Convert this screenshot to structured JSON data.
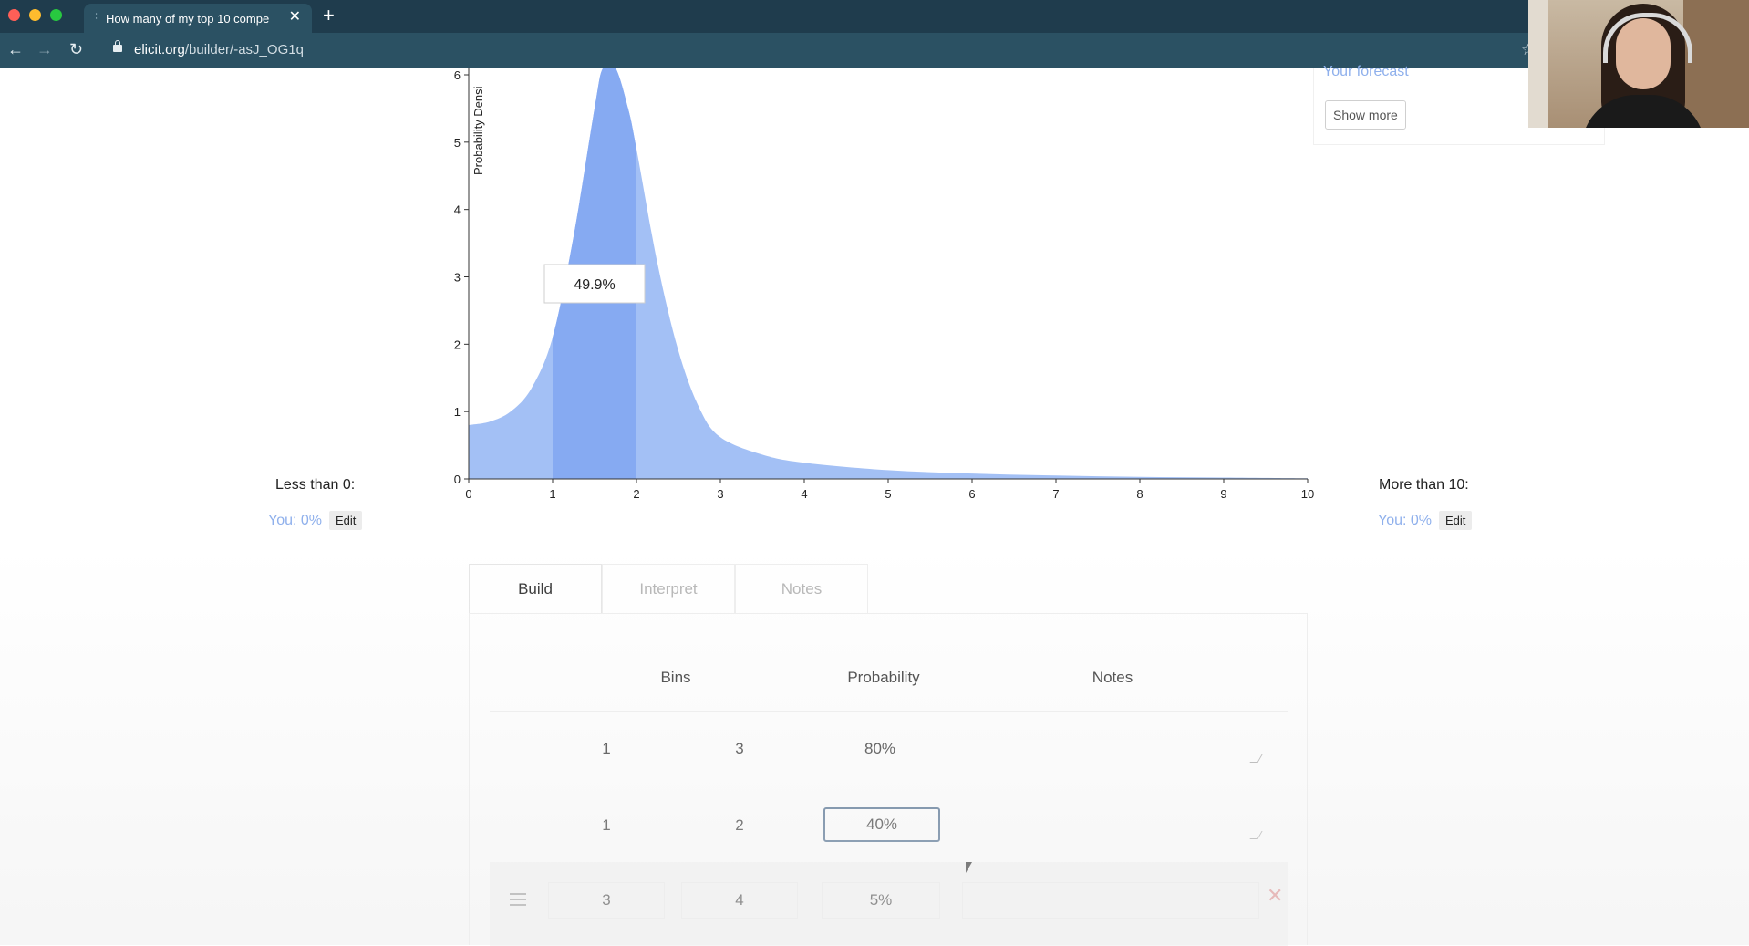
{
  "browser": {
    "tab_title": "How many of my top 10 compe",
    "tab_close": "✕",
    "new_tab": "+",
    "url_host": "elicit.org",
    "url_path": "/builder/-asJ_OG1q"
  },
  "forecast": {
    "link_text": "Your forecast",
    "show_more_label": "Show more"
  },
  "chart_data": {
    "type": "area",
    "xlabel": "",
    "ylabel": "Probability Densi",
    "x_ticks": [
      "0",
      "1",
      "2",
      "3",
      "4",
      "5",
      "6",
      "7",
      "8",
      "9",
      "10"
    ],
    "y_ticks": [
      "0",
      "1",
      "2",
      "3",
      "4",
      "5",
      "6"
    ],
    "xlim": [
      0,
      10
    ],
    "ylim": [
      0,
      6
    ],
    "x": [
      0,
      0.25,
      0.5,
      0.75,
      1,
      1.25,
      1.5,
      1.6,
      1.75,
      1.9,
      2,
      2.25,
      2.5,
      2.75,
      3,
      3.5,
      4,
      5,
      6,
      7,
      8,
      9,
      10
    ],
    "y": [
      0.8,
      0.85,
      1.0,
      1.35,
      2.1,
      3.6,
      5.5,
      6.1,
      6.1,
      5.5,
      4.9,
      3.2,
      1.9,
      1.05,
      0.62,
      0.36,
      0.24,
      0.13,
      0.08,
      0.05,
      0.03,
      0.02,
      0.01
    ],
    "highlight_range": [
      1,
      2
    ],
    "highlight_label": "49.9%",
    "fill_color": "#a3c0f5",
    "highlight_color": "#86aaf2"
  },
  "less_than": {
    "label": "Less than 0:",
    "you_text": "You: 0%",
    "edit_label": "Edit"
  },
  "more_than": {
    "label": "More than 10:",
    "you_text": "You: 0%",
    "edit_label": "Edit"
  },
  "tabs": [
    {
      "label": "Build"
    },
    {
      "label": "Interpret"
    },
    {
      "label": "Notes"
    }
  ],
  "table": {
    "headers": {
      "bins": "Bins",
      "probability": "Probability",
      "notes": "Notes"
    },
    "rows": [
      {
        "low": "1",
        "high": "3",
        "probability": "80%"
      },
      {
        "low": "1",
        "high": "2",
        "probability": "40%"
      },
      {
        "low": "3",
        "high": "4",
        "probability": "5%"
      }
    ],
    "delete_icon": "✕"
  }
}
